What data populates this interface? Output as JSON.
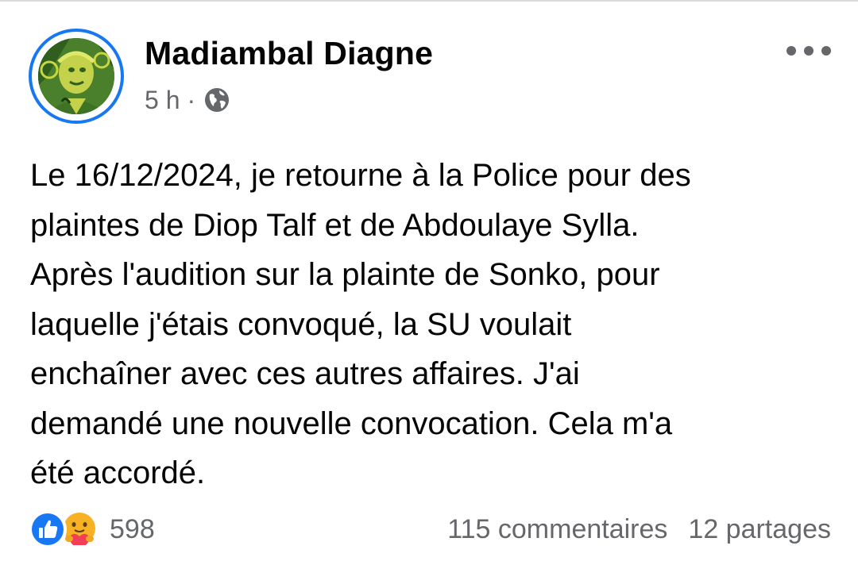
{
  "post": {
    "author": "Madiambal Diagne",
    "time": "5 h",
    "separator": "·",
    "privacy_icon": "globe-icon",
    "more_icon": "more-options-icon",
    "text": "Le 16/12/2024, je retourne à la Police pour des\nplaintes de Diop Talf et de Abdoulaye Sylla.\nAprès l'audition sur la plainte de Sonko, pour\nlaquelle j'étais convoqué, la SU voulait\nenchaîner avec ces autres affaires. J'ai\ndemandé une nouvelle convocation.  Cela m'a\nété accordé."
  },
  "footer": {
    "reaction_icons": [
      "like-icon",
      "care-icon"
    ],
    "reaction_count": "598",
    "comments": "115 commentaires",
    "shares": "12 partages"
  },
  "colors": {
    "accent": "#1877f2",
    "secondary_text": "#65676b",
    "primary_text": "#050505",
    "care_yellow": "#f7b125",
    "care_heart": "#f33e58"
  }
}
